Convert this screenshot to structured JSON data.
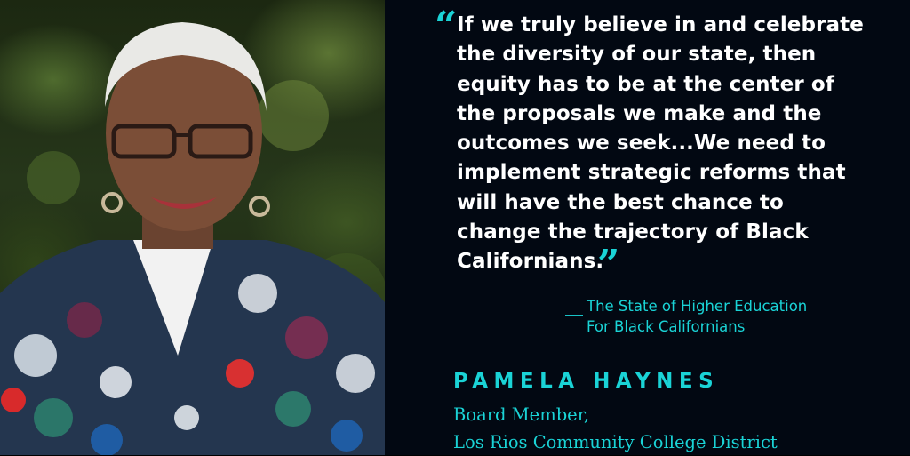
{
  "quote": {
    "lines": [
      "If we truly believe in and celebrate",
      "the diversity of our state, then",
      "equity has to be at the center of",
      "the proposals we make and the",
      "outcomes we seek...We need to",
      "implement strategic reforms that",
      "will have the best chance to",
      "change the trajectory of Black",
      "Californians."
    ]
  },
  "source": {
    "dash": "__",
    "lines": [
      "The State of Higher Education",
      "For Black Californians"
    ]
  },
  "person": {
    "name": "PAMELA HAYNES",
    "title_lines": [
      "Board Member,",
      "Los Rios Community College District"
    ]
  },
  "colors": {
    "accent": "#1ad3d6",
    "text": "#ffffff",
    "background": "#020812"
  },
  "icons": {
    "open_quote": "open-quote-icon",
    "close_quote": "close-quote-icon"
  }
}
